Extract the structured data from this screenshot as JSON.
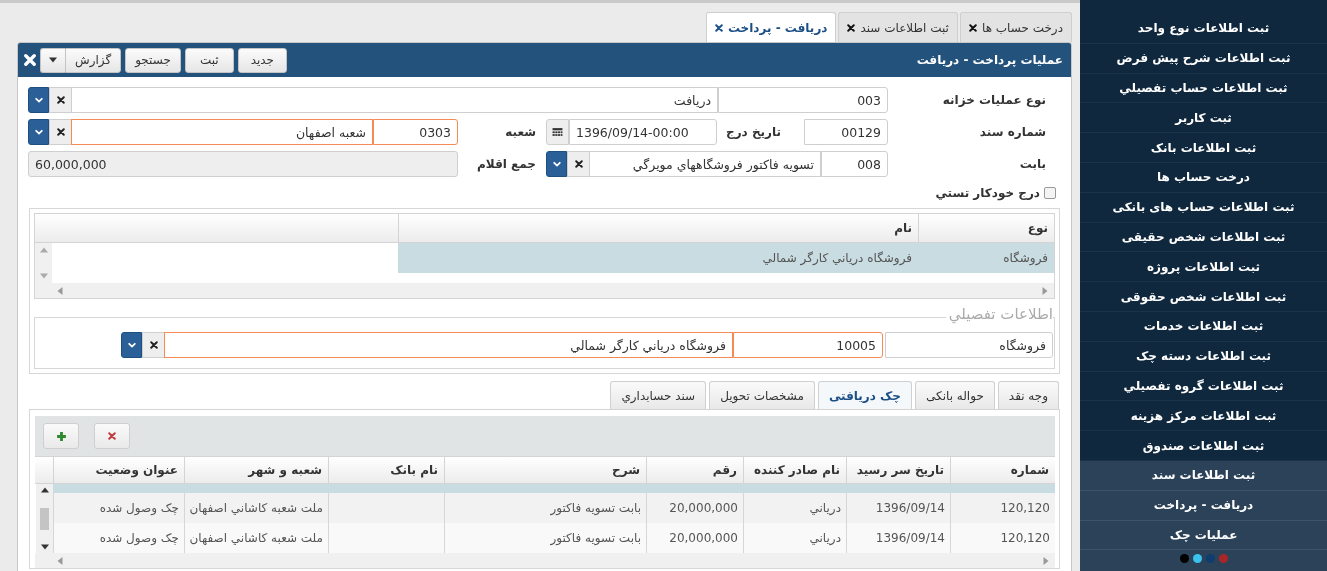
{
  "tabs": [
    {
      "label": "درخت حساب ها",
      "selected": false
    },
    {
      "label": "ثبت اطلاعات سند",
      "selected": false
    },
    {
      "label": "دريافت - پرداخت",
      "selected": true
    }
  ],
  "panel": {
    "title": "عمليات پرداخت - دريافت",
    "toolbar": [
      {
        "label": "جديد",
        "kind": "plain"
      },
      {
        "label": "ثبت",
        "kind": "plain"
      },
      {
        "label": "جستجو",
        "kind": "plain"
      },
      {
        "label": "گزارش",
        "kind": "split"
      }
    ]
  },
  "form": {
    "treasury_type": {
      "label": "نوع عمليات خزانه",
      "code": "003",
      "name": "دريافت",
      "required": false
    },
    "doc_number": {
      "label": "شماره سند",
      "value": "00129"
    },
    "entry_date": {
      "label": "تاريخ درج",
      "value": "1396/09/14-00:00"
    },
    "branch": {
      "label": "شعبه",
      "code": "0303",
      "name": "شعبه اصفهان",
      "required": true
    },
    "regarding": {
      "label": "بابت",
      "code": "008",
      "name": "تسويه فاکتور فروشگاههاي مويرگي",
      "required": false
    },
    "total": {
      "label": "جمع اقلام",
      "value": "60,000,000"
    },
    "auto_insert": {
      "label": "درج خودکار تستي",
      "checked": false
    }
  },
  "detail_grid": {
    "columns": [
      "نوع",
      "نام"
    ],
    "rows": [
      {
        "cells": [
          "فروشگاه",
          "فروشگاه درياني کارگر شمالي"
        ],
        "selected": true
      }
    ]
  },
  "detail_info": {
    "legend": "اطلاعات تفصيلي",
    "type": "فروشگاه",
    "code": "10005",
    "name": "فروشگاه درياني کارگر شمالي",
    "required": true
  },
  "payment_tabs": [
    {
      "label": "وجه نقد",
      "selected": false
    },
    {
      "label": "حواله بانکی",
      "selected": false
    },
    {
      "label": "چک دريافتی",
      "selected": true
    },
    {
      "label": "مشخصات تحويل",
      "selected": false
    },
    {
      "label": "سند حسابداري",
      "selected": false
    }
  ],
  "checks_table": {
    "columns": [
      "شماره",
      "تاريخ سر رسيد",
      "نام صادر کننده",
      "رقم",
      "شرح",
      "نام بانک",
      "شعبه و شهر",
      "عنوان وضعيت"
    ],
    "rows": [
      {
        "cells": [
          "120,120",
          "1396/09/14",
          "درياني",
          "20,000,000",
          "بابت تسويه فاکتور",
          null,
          "ملت شعبه کاشاني اصفهان",
          "چک وصول شده"
        ],
        "selected": false
      },
      {
        "cells": [
          "120,120",
          "1396/09/14",
          "درياني",
          "20,000,000",
          "بابت تسويه فاکتور",
          null,
          "ملت شعبه کاشاني اصفهان",
          "چک وصول شده"
        ],
        "selected": false
      }
    ]
  },
  "sidebar": {
    "menu_items": [
      {
        "label": "ثبت اطلاعات نوع واحد"
      },
      {
        "label": "ثبت اطلاعات شرح پيش فرض"
      },
      {
        "label": "ثبت اطلاعات حساب تفصيلي"
      },
      {
        "label": "ثبت کاربر"
      },
      {
        "label": "ثبت اطلاعات بانک"
      },
      {
        "label": "درخت حساب ها"
      },
      {
        "label": "ثبت اطلاعات حساب های بانکی"
      },
      {
        "label": "ثبت اطلاعات شخص حقيقی"
      },
      {
        "label": "ثبت اطلاعات پروژه"
      },
      {
        "label": "ثبت اطلاعات شخص حقوقی"
      },
      {
        "label": "ثبت اطلاعات خدمات"
      },
      {
        "label": "ثبت اطلاعات دسته چک"
      },
      {
        "label": "ثبت اطلاعات گروه تفصيلي"
      },
      {
        "label": "ثبت اطلاعات مرکز هزينه"
      },
      {
        "label": "ثبت اطلاعات صندوق"
      }
    ],
    "open_group_items": [
      {
        "label": "ثبت اطلاعات سند"
      },
      {
        "label": "دريافت - پرداخت"
      },
      {
        "label": "عمليات چک"
      }
    ],
    "theme_colors": [
      {
        "color": "#000000"
      },
      {
        "color": "#3ac3ef"
      },
      {
        "color": "#0e3d6e"
      },
      {
        "color": "#a82626"
      }
    ]
  }
}
